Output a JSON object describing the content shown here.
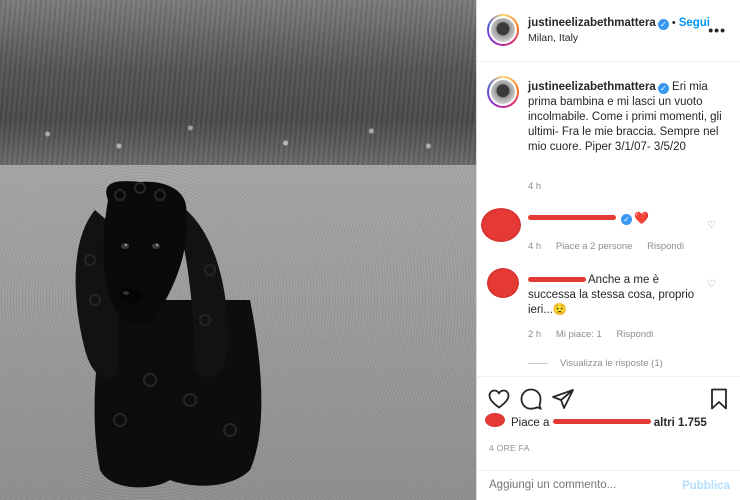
{
  "post": {
    "author": "justineelizabethmattera",
    "follow_label": "Segui",
    "separator": "•",
    "location": "Milan, Italy",
    "caption": "Eri mia prima bambina e mi lasci un vuoto incolmabile. Come i primi momenti, gli ultimi- Fra le mie braccia. Sempre nel mio cuore. Piper 3/1/07- 3/5/20",
    "caption_time": "4 h",
    "more_icon": "ellipsis-icon"
  },
  "comments": [
    {
      "time": "4 h",
      "likes": "Piace a 2 persone",
      "reply": "Rispondi",
      "emoji": "❤️"
    },
    {
      "text": "Anche a me è successa la stessa cosa, proprio ieri...😟",
      "time": "2 h",
      "likes": "Mi piace: 1",
      "reply": "Rispondi"
    }
  ],
  "view_replies": "Visualizza le risposte (1)",
  "likes_text": {
    "prefix": "Piace a",
    "suffix": "altri 1.755"
  },
  "post_time": "4 ORE FA",
  "comment_placeholder": "Aggiungi un commento...",
  "publish_label": "Pubblica",
  "icons": {
    "like": "heart-icon",
    "comment": "comment-icon",
    "share": "paper-plane-icon",
    "save": "bookmark-icon"
  },
  "colors": {
    "link": "#0095f6",
    "verified": "#3897f0",
    "muted": "#8e8e8e",
    "redaction": "#e53935"
  }
}
